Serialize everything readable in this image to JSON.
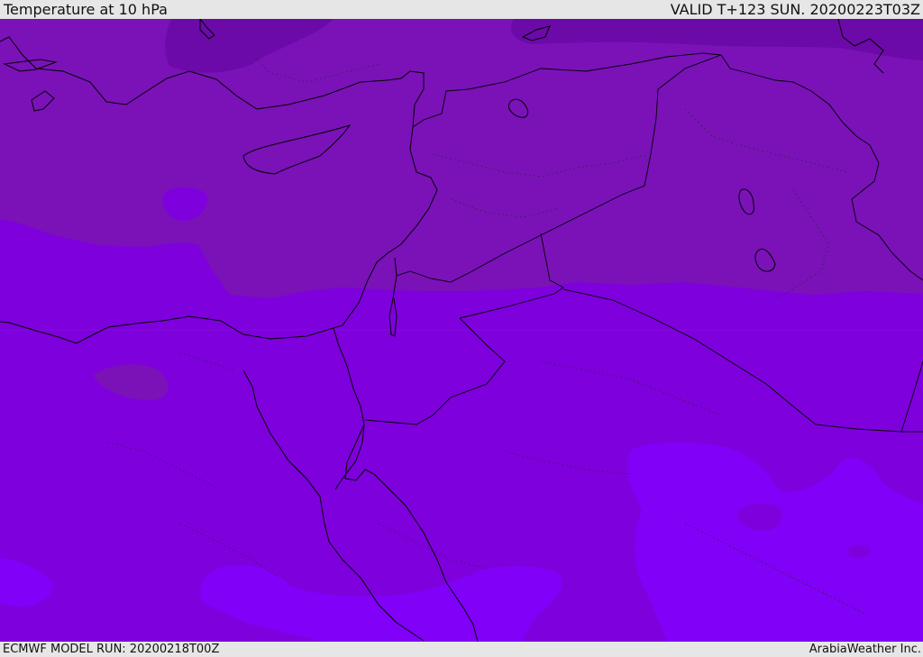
{
  "header": {
    "title": "Temperature at 10 hPa",
    "valid": "VALID T+123 SUN. 20200223T03Z"
  },
  "footer": {
    "model_run": "ECMWF MODEL RUN: 20200218T00Z",
    "credit": "ArabiaWeather Inc."
  },
  "colors": {
    "band_cold": "#6b0aa8",
    "band_cool": "#7a12b8",
    "band_mid": "#7e00dc",
    "band_warm": "#8000f8",
    "coastline": "#000000"
  }
}
